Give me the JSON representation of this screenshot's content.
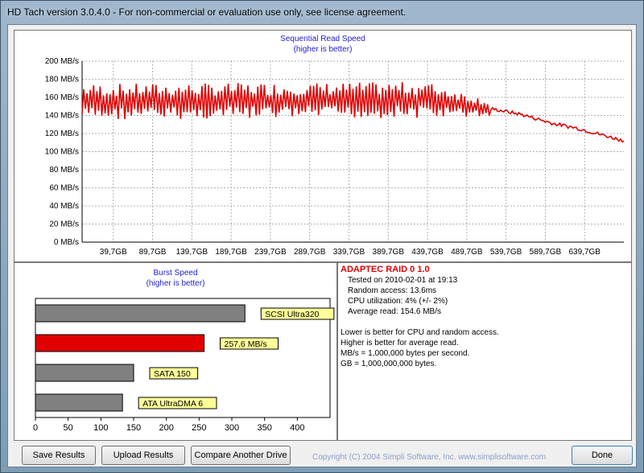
{
  "window": {
    "title": "HD Tach version 3.0.4.0  - For non-commercial or evaluation use only, see license agreement."
  },
  "sequential": {
    "title": "Sequential Read Speed",
    "subtitle": "(higher is better)"
  },
  "burst": {
    "title": "Burst Speed",
    "subtitle": "(higher is better)"
  },
  "info": {
    "drive_name": "ADAPTEC RAID 0 1.0",
    "tested_on": "Tested on 2010-02-01 at 19:13",
    "random_access": "Random access: 13.6ms",
    "cpu": "CPU utilization: 4% (+/- 2%)",
    "average_read": "Average read: 154.6 MB/s",
    "notes": [
      "Lower is better for CPU and random access.",
      "Higher is better for average read.",
      "MB/s = 1,000,000 bytes per second.",
      "GB = 1,000,000,000 bytes."
    ]
  },
  "buttons": {
    "save": "Save Results",
    "upload": "Upload Results",
    "compare": "Compare Another Drive",
    "done": "Done"
  },
  "copyright": "Copyright (C) 2004 Simpli Software, Inc. www.simplisoftware.com",
  "colors": {
    "series": "#e00000",
    "reference_bar": "#808080",
    "label_bg": "#ffff99",
    "title": "#1c1ccf"
  },
  "chart_data": [
    {
      "type": "line",
      "title": "Sequential Read Speed",
      "subtitle": "(higher is better)",
      "ylim": [
        0,
        200
      ],
      "y_ticks": [
        "0 MB/s",
        "20 MB/s",
        "40 MB/s",
        "60 MB/s",
        "80 MB/s",
        "100 MB/s",
        "120 MB/s",
        "140 MB/s",
        "160 MB/s",
        "180 MB/s",
        "200 MB/s"
      ],
      "x_ticks": [
        "39,7GB",
        "89,7GB",
        "139,7GB",
        "189,7GB",
        "239,7GB",
        "289,7GB",
        "339,7GB",
        "389,7GB",
        "439,7GB",
        "489,7GB",
        "539,7GB",
        "589,7GB",
        "639,7GB"
      ],
      "x_range_gb": [
        0,
        689.7
      ],
      "grid": true,
      "series": [
        {
          "x_gb": [
            0,
            439.7,
            460,
            500,
            530,
            560,
            600,
            630,
            660,
            690
          ],
          "y": [
            155,
            157,
            155,
            150,
            146,
            141,
            131,
            126,
            119,
            112
          ],
          "fluctuation_mbps": 20
        }
      ]
    },
    {
      "type": "bar",
      "title": "Burst Speed",
      "subtitle": "(higher is better)",
      "orientation": "horizontal",
      "xlim": [
        0,
        450
      ],
      "x_ticks": [
        "0",
        "50",
        "100",
        "150",
        "200",
        "250",
        "300",
        "350",
        "400"
      ],
      "categories": [
        "SCSI Ultra320",
        "257.6 MB/s",
        "SATA 150",
        "ATA UltraDMA 6"
      ],
      "values": [
        320,
        257.6,
        150,
        133
      ],
      "highlight_index": 1
    }
  ]
}
